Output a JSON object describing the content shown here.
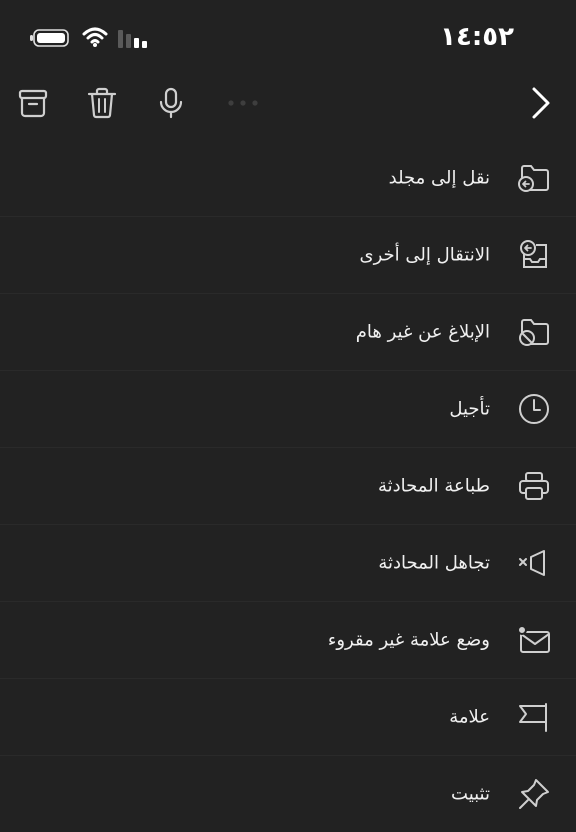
{
  "status_bar": {
    "time": "١٤:٥٢",
    "icons": [
      "battery-icon",
      "wifi-icon",
      "cellular-signal-icon"
    ]
  },
  "toolbar": {
    "icons": [
      "archive-icon",
      "trash-icon",
      "microphone-icon",
      "more-dots-icon",
      "chevron-right-icon"
    ]
  },
  "menu": {
    "items": [
      {
        "label": "نقل إلى مجلد",
        "icon": "move-to-folder-icon"
      },
      {
        "label": "الانتقال إلى أخرى",
        "icon": "move-to-other-icon"
      },
      {
        "label": "الإبلاغ عن غير هام",
        "icon": "report-junk-icon"
      },
      {
        "label": "تأجيل",
        "icon": "clock-icon"
      },
      {
        "label": "طباعة المحادثة",
        "icon": "printer-icon"
      },
      {
        "label": "تجاهل المحادثة",
        "icon": "mute-icon"
      },
      {
        "label": "وضع علامة غير مقروء",
        "icon": "mark-unread-icon"
      },
      {
        "label": "علامة",
        "icon": "flag-icon"
      },
      {
        "label": "تثبيت",
        "icon": "pin-icon"
      }
    ]
  },
  "colors": {
    "background": "#222222",
    "text": "#f0f0f0",
    "icon": "#cfcfcf",
    "divider": "#2a2a2a"
  }
}
